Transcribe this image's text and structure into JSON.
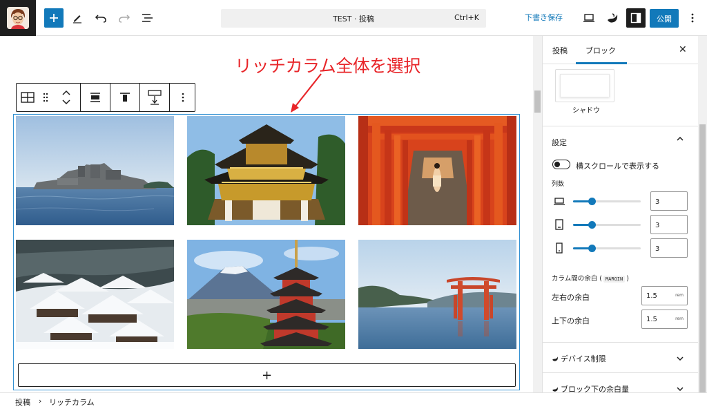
{
  "header": {
    "document_title": "TEST · 投稿",
    "shortcut": "Ctrl+K",
    "save_draft_label": "下書き保存",
    "publish_label": "公開",
    "icons": [
      "site-avatar",
      "plus-icon",
      "pencil-icon",
      "undo-icon",
      "redo-icon",
      "list-view-icon",
      "desktop-icon",
      "pro-icon",
      "sidebar-toggle-icon",
      "more-vertical-icon"
    ]
  },
  "annotation": {
    "text": "リッチカラム全体を選択",
    "color": "#e8262a"
  },
  "block_toolbar": {
    "icons": [
      "rich-column-icon",
      "drag-handle-icon",
      "move-up-down-icon",
      "align-wide-icon",
      "align-top-icon",
      "vertical-spacing-icon",
      "more-vertical-icon"
    ]
  },
  "rich_column": {
    "columns": [
      "Gunkanjima island",
      "Nikko Toshogu Yomeimon gate",
      "Fushimi Inari torii tunnel",
      "Shirakawa-go snowy village",
      "Mt. Fuji with Chureito pagoda",
      "Itsukushima floating torii"
    ],
    "add_block_symbol": "+"
  },
  "sidebar": {
    "tabs": [
      {
        "label": "投稿",
        "active": false
      },
      {
        "label": "ブロック",
        "active": true
      }
    ],
    "close_symbol": "✕",
    "shadow_label": "シャドウ",
    "settings": {
      "title": "設定",
      "horizontal_scroll_label": "横スクロールで表示する",
      "horizontal_scroll_on": false,
      "columns_label": "列数",
      "columns": [
        {
          "device": "desktop",
          "value": "3",
          "level": 0.28
        },
        {
          "device": "tablet",
          "value": "3",
          "level": 0.28
        },
        {
          "device": "mobile",
          "value": "3",
          "level": 0.28
        }
      ],
      "gap_label_prefix": "カラム間の余白 (",
      "gap_label_code": "MARGIN",
      "gap_label_suffix": ")",
      "horizontal_gap_label": "左右の余白",
      "horizontal_gap_value": "1.5",
      "vertical_gap_label": "上下の余白",
      "vertical_gap_value": "1.5",
      "unit": "rem"
    },
    "device_limit_label": "デバイス制限",
    "block_bottom_margin_label": "ブロック下の余白量"
  },
  "breadcrumb": {
    "items": [
      "投稿",
      "リッチカラム"
    ],
    "separator": "›"
  },
  "colors": {
    "accent": "#1279ba",
    "selection_outline": "#3592d3",
    "annotation": "#e8262a"
  }
}
